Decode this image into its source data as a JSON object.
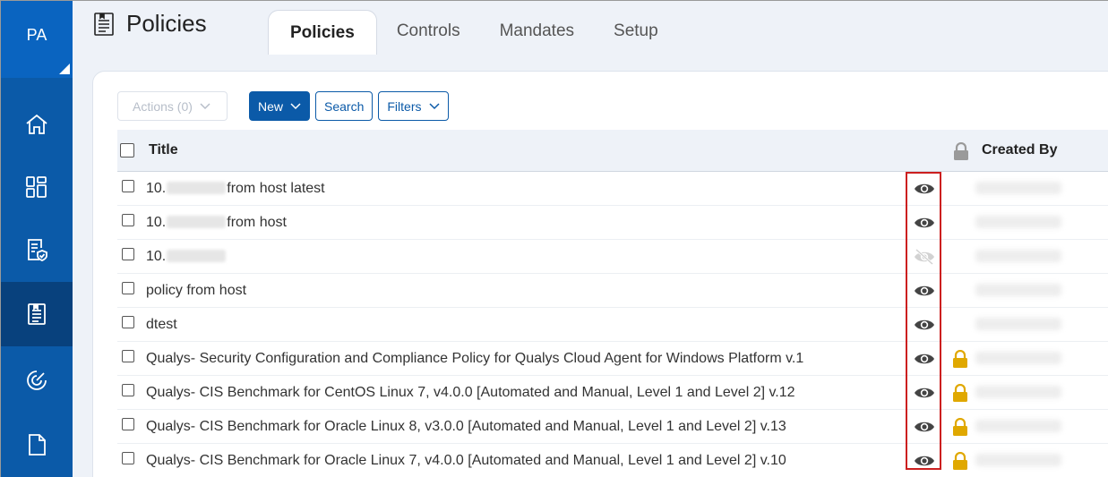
{
  "sidebar": {
    "avatar_initials": "PA",
    "items": [
      {
        "icon": "home-icon",
        "active": false
      },
      {
        "icon": "dashboard-icon",
        "active": false
      },
      {
        "icon": "compliance-report-icon",
        "active": false
      },
      {
        "icon": "policy-document-icon",
        "active": true
      },
      {
        "icon": "scan-gauge-icon",
        "active": false
      },
      {
        "icon": "file-icon",
        "active": false
      }
    ]
  },
  "header": {
    "page_title": "Policies",
    "tabs": [
      {
        "label": "Policies",
        "active": true
      },
      {
        "label": "Controls",
        "active": false
      },
      {
        "label": "Mandates",
        "active": false
      },
      {
        "label": "Setup",
        "active": false
      }
    ]
  },
  "toolbar": {
    "actions_label": "Actions (0)",
    "new_label": "New",
    "search_label": "Search",
    "filters_label": "Filters"
  },
  "table": {
    "columns": {
      "title": "Title",
      "created_by": "Created By"
    },
    "rows": [
      {
        "title_prefix": "10.",
        "title_suffix": "from host latest",
        "redacted": true,
        "visible": true,
        "locked": false
      },
      {
        "title_prefix": "10.",
        "title_suffix": "from host",
        "redacted": true,
        "visible": true,
        "locked": false
      },
      {
        "title_prefix": "10.",
        "title_suffix": "",
        "redacted": true,
        "visible": false,
        "locked": false
      },
      {
        "title_prefix": "policy from host",
        "title_suffix": "",
        "redacted": false,
        "visible": true,
        "locked": false
      },
      {
        "title_prefix": "dtest",
        "title_suffix": "",
        "redacted": false,
        "visible": true,
        "locked": false
      },
      {
        "title_prefix": "Qualys- Security Configuration and Compliance Policy for Qualys Cloud Agent for Windows Platform v.1",
        "title_suffix": "",
        "redacted": false,
        "visible": true,
        "locked": true
      },
      {
        "title_prefix": "Qualys- CIS Benchmark for CentOS Linux 7, v4.0.0 [Automated and Manual, Level 1 and Level 2] v.12",
        "title_suffix": "",
        "redacted": false,
        "visible": true,
        "locked": true
      },
      {
        "title_prefix": "Qualys- CIS Benchmark for Oracle Linux 8, v3.0.0 [Automated and Manual, Level 1 and Level 2] v.13",
        "title_suffix": "",
        "redacted": false,
        "visible": true,
        "locked": true
      },
      {
        "title_prefix": "Qualys- CIS Benchmark for Oracle Linux 7, v4.0.0 [Automated and Manual, Level 1 and Level 2] v.10",
        "title_suffix": "",
        "redacted": false,
        "visible": true,
        "locked": true
      }
    ]
  },
  "colors": {
    "sidebar": "#0b5aa8",
    "sidebar_active": "#08417d",
    "primary": "#0b5aa8",
    "lock": "#e0a800",
    "highlight": "#cc1f1f"
  }
}
